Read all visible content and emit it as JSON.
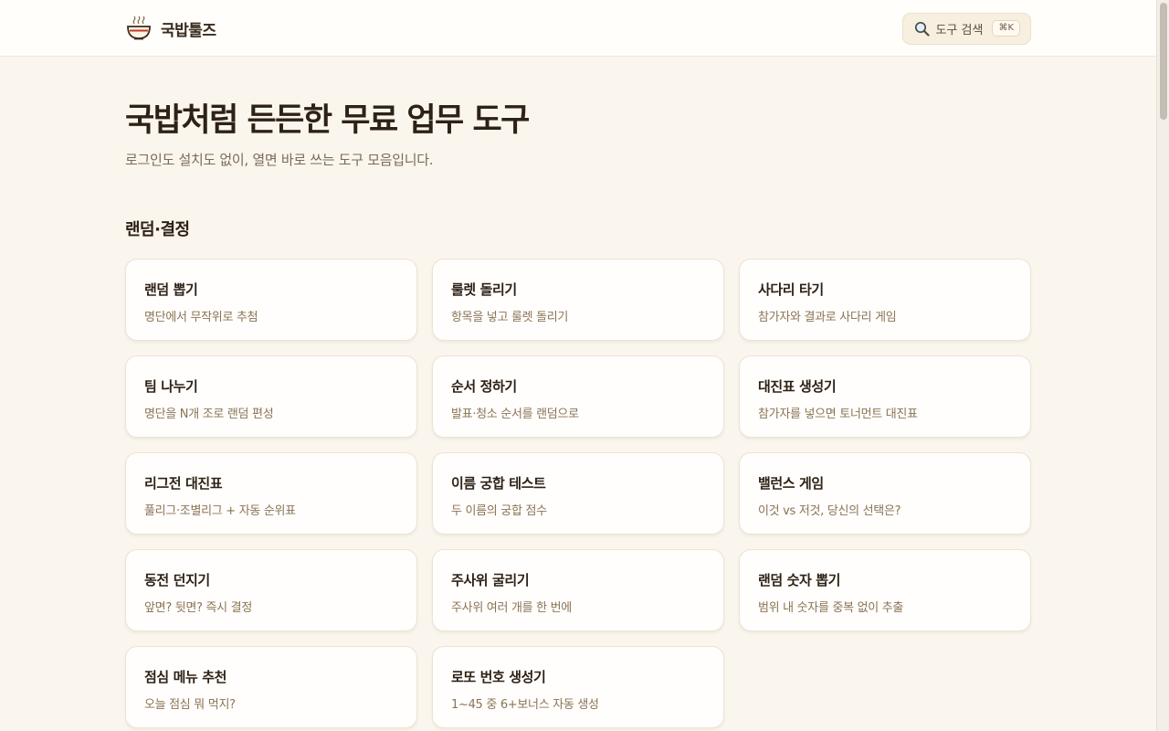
{
  "header": {
    "brand_icon": "gukbap-bowl-icon",
    "brand_name": "국밥툴즈",
    "search_icon": "search-icon",
    "search_label": "도구 검색",
    "search_shortcut": "⌘K"
  },
  "hero": {
    "title": "국밥처럼 든든한 무료 업무 도구",
    "subtitle": "로그인도 설치도 없이, 열면 바로 쓰는 도구 모음입니다."
  },
  "section": {
    "title": "랜덤·결정",
    "tools": [
      {
        "title": "랜덤 뽑기",
        "desc": "명단에서 무작위로 추첨"
      },
      {
        "title": "룰렛 돌리기",
        "desc": "항목을 넣고 룰렛 돌리기"
      },
      {
        "title": "사다리 타기",
        "desc": "참가자와 결과로 사다리 게임"
      },
      {
        "title": "팀 나누기",
        "desc": "명단을 N개 조로 랜덤 편성"
      },
      {
        "title": "순서 정하기",
        "desc": "발표·청소 순서를 랜덤으로"
      },
      {
        "title": "대진표 생성기",
        "desc": "참가자를 넣으면 토너먼트 대진표"
      },
      {
        "title": "리그전 대진표",
        "desc": "풀리그·조별리그 + 자동 순위표"
      },
      {
        "title": "이름 궁합 테스트",
        "desc": "두 이름의 궁합 점수"
      },
      {
        "title": "밸런스 게임",
        "desc": "이것 vs 저것, 당신의 선택은?"
      },
      {
        "title": "동전 던지기",
        "desc": "앞면? 뒷면? 즉시 결정"
      },
      {
        "title": "주사위 굴리기",
        "desc": "주사위 여러 개를 한 번에"
      },
      {
        "title": "랜덤 숫자 뽑기",
        "desc": "범위 내 숫자를 중복 없이 추출"
      },
      {
        "title": "점심 메뉴 추천",
        "desc": "오늘 점심 뭐 먹지?"
      },
      {
        "title": "로또 번호 생성기",
        "desc": "1~45 중 6+보너스 자동 생성"
      }
    ]
  },
  "colors": {
    "background": "#faf6ee",
    "card": "#fffefc",
    "title_text": "#2e2116",
    "desc_text": "#8a7355",
    "brand_accent": "#c0392b"
  }
}
